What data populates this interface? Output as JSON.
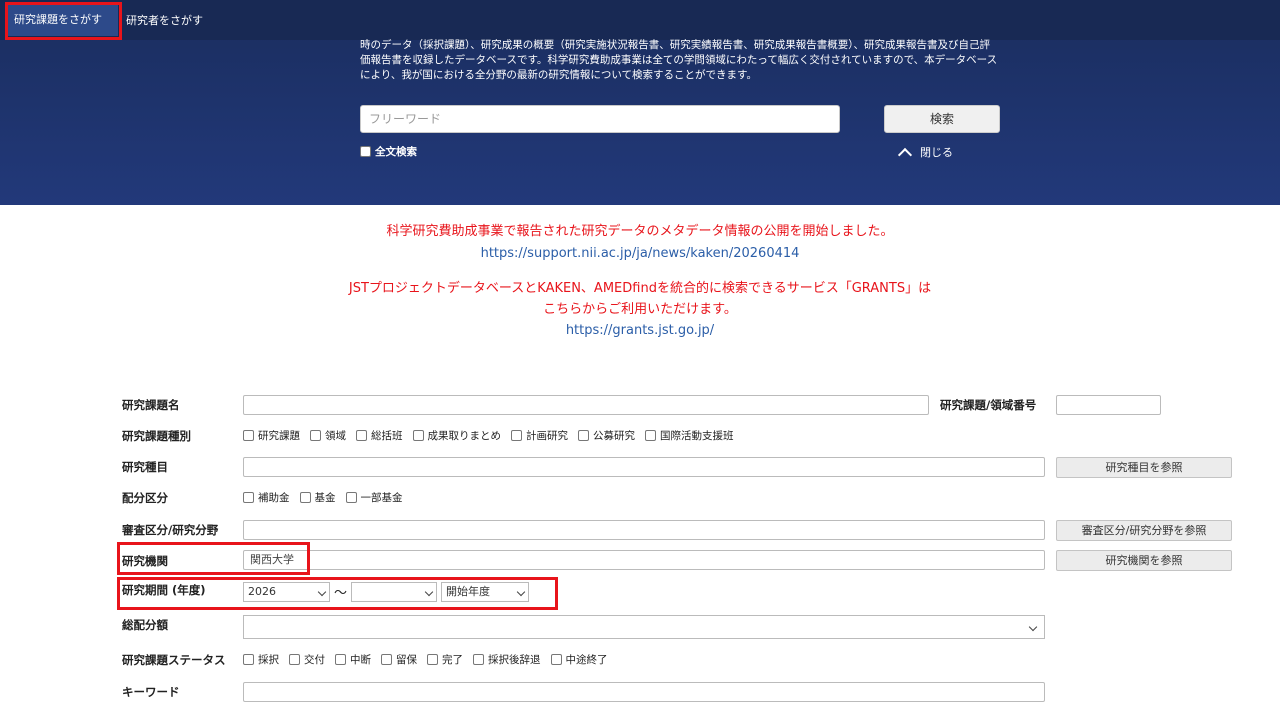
{
  "nav": {
    "tab_projects": "研究課題をさがす",
    "tab_researchers": "研究者をさがす"
  },
  "hero": {
    "description": "時のデータ（採択課題）、研究成果の概要（研究実施状況報告書、研究実績報告書、研究成果報告書概要）、研究成果報告書及び自己評価報告書を収録したデータベースです。科学研究費助成事業は全ての学問領域にわたって幅広く交付されていますので、本データベースにより、我が国における全分野の最新の研究情報について検索することができます。",
    "search_placeholder": "フリーワード",
    "search_button": "検索",
    "fulltext_label": "全文検索",
    "close_label": "閉じる"
  },
  "notices": {
    "n1_text": "科学研究費助成事業で報告された研究データのメタデータ情報の公開を開始しました。",
    "n1_link": "https://support.nii.ac.jp/ja/news/kaken/20260414",
    "n2_line1": "JSTプロジェクトデータベースとKAKEN、AMEDfindを統合的に検索できるサービス「GRANTS」は",
    "n2_line2": "こちらからご利用いただけます。",
    "n2_link": "https://grants.jst.go.jp/"
  },
  "form": {
    "title_label": "研究課題名",
    "number_label": "研究課題/領域番号",
    "type_label": "研究課題種別",
    "type_options": [
      "研究課題",
      "領域",
      "総括班",
      "成果取りまとめ",
      "計画研究",
      "公募研究",
      "国際活動支援班"
    ],
    "category_label": "研究種目",
    "category_btn": "研究種目を参照",
    "allocation_label": "配分区分",
    "allocation_options": [
      "補助金",
      "基金",
      "一部基金"
    ],
    "field_label": "審査区分/研究分野",
    "field_btn": "審査区分/研究分野を参照",
    "institution_label": "研究機関",
    "institution_value": "関西大学",
    "institution_btn": "研究機関を参照",
    "period_label": "研究期間 (年度)",
    "period_from": "2026",
    "period_tilde": "〜",
    "period_to": "",
    "period_basis": "開始年度",
    "amount_label": "総配分額",
    "status_label": "研究課題ステータス",
    "status_options": [
      "採択",
      "交付",
      "中断",
      "留保",
      "完了",
      "採択後辞退",
      "中途終了"
    ],
    "keyword_label": "キーワード"
  }
}
